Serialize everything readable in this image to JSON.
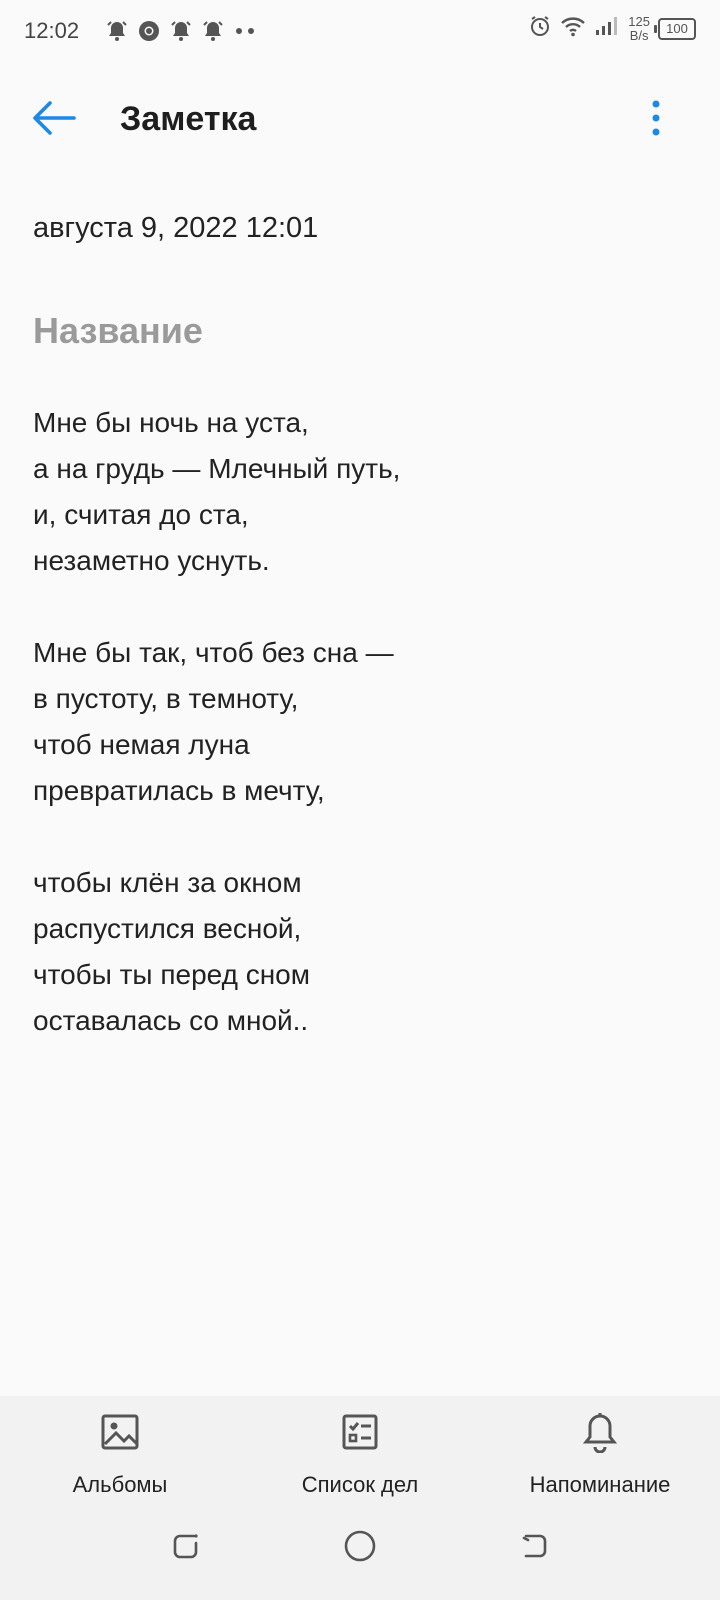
{
  "status_bar": {
    "time": "12:02",
    "net_speed_value": "125",
    "net_speed_unit": "B/s",
    "battery": "100",
    "notification_icons": [
      "alarm-bell-icon",
      "chrome-icon",
      "alarm-bell-icon",
      "alarm-bell-icon",
      "more-dots-icon"
    ],
    "system_icons": [
      "alarm-clock-icon",
      "wifi-icon",
      "signal-icon",
      "battery-icon"
    ]
  },
  "app_bar": {
    "title": "Заметка",
    "back_icon": "arrow-left-icon",
    "menu_icon": "more-vert-icon",
    "accent_color": "#1e88e5"
  },
  "note": {
    "date": "августа 9, 2022 12:01",
    "title_placeholder": "Название",
    "body": "Мне бы ночь на уста,\nа на грудь — Млечный путь,\nи, считая до ста,\nнезаметно уснуть.\n\nМне бы так, чтоб без сна —\nв пустоту, в темноту,\nчтоб немая луна\nпревратилась в мечту,\n\nчтобы клён за окном\nраспустился весной,\nчтобы ты перед сном\nоставалась со мной.."
  },
  "toolbar": {
    "albums_label": "Альбомы",
    "todo_label": "Список дел",
    "reminder_label": "Напоминание"
  },
  "nav": {
    "icons": [
      "recents-icon",
      "home-icon",
      "back-nav-icon"
    ]
  }
}
